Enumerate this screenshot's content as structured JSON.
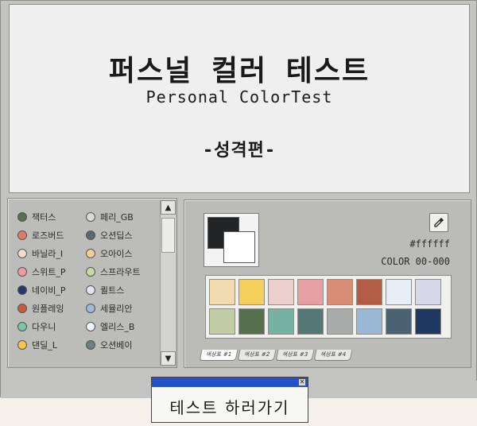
{
  "title": {
    "main": "퍼스널 컬러 테스트",
    "sub": "Personal ColorTest",
    "part": "-성격편-"
  },
  "color_list": [
    {
      "label": "잭터스",
      "color": "#5b6f52"
    },
    {
      "label": "페리_GB",
      "color": "#d9d9d7"
    },
    {
      "label": "로즈버드",
      "color": "#e07b68"
    },
    {
      "label": "오션딥스",
      "color": "#586870"
    },
    {
      "label": "바닐라_I",
      "color": "#f6d9cf"
    },
    {
      "label": "오아이스",
      "color": "#f2cf97"
    },
    {
      "label": "스위트_P",
      "color": "#ee9aa5"
    },
    {
      "label": "스프라우트",
      "color": "#c6d8a3"
    },
    {
      "label": "네이비_P",
      "color": "#223a68"
    },
    {
      "label": "퀼트스",
      "color": "#e7e0f3"
    },
    {
      "label": "원플레잉",
      "color": "#c45b3d"
    },
    {
      "label": "세뮬리안",
      "color": "#9fb8dc"
    },
    {
      "label": "다우니",
      "color": "#7ec2a7"
    },
    {
      "label": "엘리스_B",
      "color": "#eff3fb"
    },
    {
      "label": "댄딜_L",
      "color": "#f6c54c"
    },
    {
      "label": "오션베이",
      "color": "#67827f"
    }
  ],
  "palette": {
    "fg_color": "#222425",
    "bg_color": "#ffffff",
    "hex_value": "#ffffff",
    "code_text": "COLOR 00-000",
    "swatches": [
      "#f2dbb1",
      "#f5cf5c",
      "#ebcfcd",
      "#e79ea2",
      "#d98d76",
      "#b25c44",
      "#e7eef6",
      "#d9d8ea",
      "#c2cda5",
      "#57704e",
      "#76b1a1",
      "#557876",
      "#a7abaa",
      "#9ab7d6",
      "#4a6272",
      "#1f3962"
    ],
    "tabs": [
      "색상표 #1",
      "색상표 #2",
      "색상표 #3",
      "색상표 #4"
    ]
  },
  "popup": {
    "close_symbol": "✕",
    "button_label": "테스트 하러가기"
  },
  "scrollbar": {
    "up_symbol": "▲",
    "down_symbol": "▼"
  }
}
